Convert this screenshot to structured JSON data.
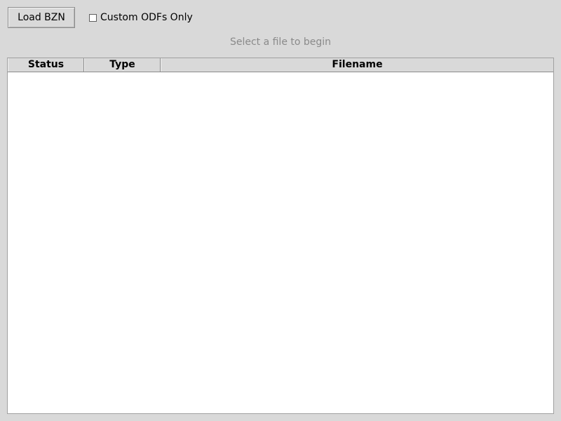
{
  "toolbar": {
    "load_label": "Load BZN",
    "custom_odfs_label": "Custom ODFs Only",
    "custom_odfs_checked": false
  },
  "status": {
    "message": "Select a file to begin"
  },
  "table": {
    "columns": [
      "Status",
      "Type",
      "Filename"
    ],
    "rows": []
  },
  "colors": {
    "window_bg": "#d9d9d9",
    "table_bg": "#ffffff",
    "status_text": "#8a8a8a"
  }
}
